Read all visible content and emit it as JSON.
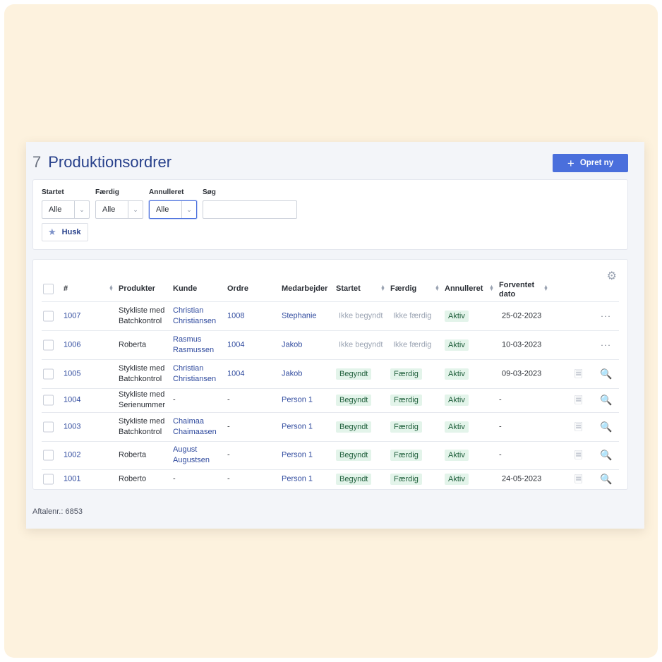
{
  "header": {
    "count": "7",
    "title": "Produktionsordrer",
    "create_label": "Opret ny"
  },
  "filters": {
    "started": {
      "label": "Startet",
      "value": "Alle"
    },
    "finished": {
      "label": "Færdig",
      "value": "Alle"
    },
    "cancelled": {
      "label": "Annulleret",
      "value": "Alle"
    },
    "search": {
      "label": "Søg",
      "value": ""
    },
    "remember_label": "Husk"
  },
  "table": {
    "columns": [
      "#",
      "Produkter",
      "Kunde",
      "Ordre",
      "Medarbejder",
      "Startet",
      "Færdig",
      "Annulleret",
      "Forventet dato"
    ],
    "rows": [
      {
        "id": "1007",
        "product": "Stykliste med Batchkontrol",
        "customer": "Christian Christiansen",
        "order": "1008",
        "employee": "Stephanie",
        "started": "Ikke begyndt",
        "finished": "Ikke færdig",
        "cancelled": "Aktiv",
        "date": "25-02-2023",
        "action": "more"
      },
      {
        "id": "1006",
        "product": "Roberta",
        "customer": "Rasmus Rasmussen",
        "order": "1004",
        "employee": "Jakob",
        "started": "Ikke begyndt",
        "finished": "Ikke færdig",
        "cancelled": "Aktiv",
        "date": "10-03-2023",
        "action": "more"
      },
      {
        "id": "1005",
        "product": "Stykliste med Batchkontrol",
        "customer": "Christian Christiansen",
        "order": "1004",
        "employee": "Jakob",
        "started": "Begyndt",
        "finished": "Færdig",
        "cancelled": "Aktiv",
        "date": "09-03-2023",
        "action": "icons"
      },
      {
        "id": "1004",
        "product": "Stykliste med Serienummer",
        "customer": "-",
        "order": "-",
        "employee": "Person 1",
        "started": "Begyndt",
        "finished": "Færdig",
        "cancelled": "Aktiv",
        "date": "-",
        "action": "icons"
      },
      {
        "id": "1003",
        "product": "Stykliste med Batchkontrol",
        "customer": "Chaimaa Chaimaasen",
        "order": "-",
        "employee": "Person 1",
        "started": "Begyndt",
        "finished": "Færdig",
        "cancelled": "Aktiv",
        "date": "-",
        "action": "icons"
      },
      {
        "id": "1002",
        "product": "Roberta",
        "customer": "August Augustsen",
        "order": "-",
        "employee": "Person 1",
        "started": "Begyndt",
        "finished": "Færdig",
        "cancelled": "Aktiv",
        "date": "-",
        "action": "icons"
      },
      {
        "id": "1001",
        "product": "Roberto",
        "customer": "-",
        "order": "-",
        "employee": "Person 1",
        "started": "Begyndt",
        "finished": "Færdig",
        "cancelled": "Aktiv",
        "date": "24-05-2023",
        "action": "icons"
      }
    ]
  },
  "footer": {
    "agreement": "Aftalenr.: 6853"
  },
  "icons": {
    "settings": "gear-icon",
    "more": "ellipsis-icon",
    "copy": "copy-icon",
    "view": "document-search-icon",
    "remember": "star-icon",
    "add": "plus-icon"
  },
  "colors": {
    "accent": "#4a6fdc",
    "title": "#27408b",
    "tag_bg": "#e3f4ea",
    "tag_text": "#1e5e3a"
  }
}
